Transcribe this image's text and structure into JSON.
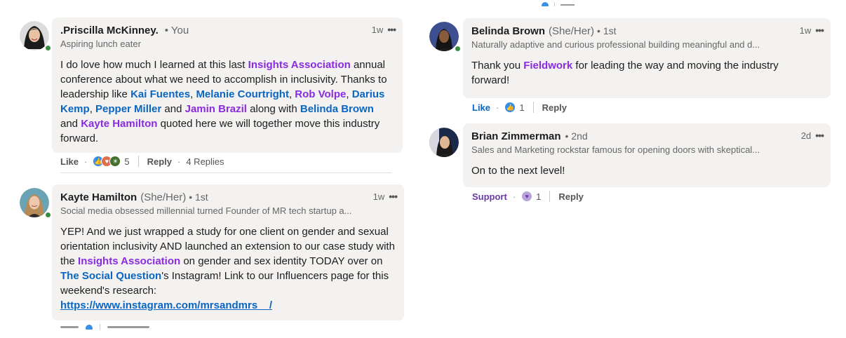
{
  "comments": [
    {
      "name": ".Priscilla McKinney.",
      "badge": "• You",
      "headline": "Aspiring lunch eater",
      "time": "1w",
      "body": {
        "p1": "I do love how much I learned at this last ",
        "m1": "Insights Association",
        "p2": " annual conference about what we need to accomplish in inclusivity. Thanks to leadership like ",
        "m2": "Kai Fuentes",
        "p3": ", ",
        "m3": "Melanie Courtright",
        "p4": ", ",
        "m4": "Rob Volpe",
        "p5": ", ",
        "m5": "Darius Kemp",
        "p6": ", ",
        "m6": "Pepper Miller",
        "p7": " and ",
        "m7": "Jamin Brazil",
        "p8": " along with ",
        "m8": "Belinda Brown",
        "p9": " and ",
        "m9": "Kayte Hamilton",
        "p10": " quoted here we will together move this industry forward."
      },
      "actions": {
        "like": "Like",
        "reaction_count": "5",
        "reply": "Reply",
        "replies": "4 Replies"
      }
    },
    {
      "name": "Kayte Hamilton",
      "pronouns": "(She/Her)",
      "degree": "• 1st",
      "headline": "Social media obsessed millennial turned Founder of MR tech startup a...",
      "time": "1w",
      "body": {
        "p1": "YEP! And we just wrapped a study for one client on gender and sexual orientation inclusivity AND launched an extension to our case study with the ",
        "m1": "Insights Association",
        "p2": " on gender and sex identity TODAY over on ",
        "m2": "The Social Question",
        "p3": "'s Instagram! Link to our Influencers page for this weekend's research:",
        "link": "https://www.instagram.com/mrsandmrs__/"
      }
    },
    {
      "name": "Belinda Brown",
      "pronouns": "(She/Her)",
      "degree": "• 1st",
      "headline": "Naturally adaptive and curious professional building meaningful and d...",
      "time": "1w",
      "body": {
        "p1": "Thank you ",
        "m1": "Fieldwork",
        "p2": " for leading the way and moving the industry forward!"
      },
      "actions": {
        "like": "Like",
        "reaction_count": "1",
        "reply": "Reply"
      }
    },
    {
      "name": "Brian Zimmerman",
      "degree": "• 2nd",
      "headline": "Sales and Marketing rockstar famous for opening doors with skeptical...",
      "time": "2d",
      "body": {
        "p1": "On to the next level!"
      },
      "actions": {
        "support": "Support",
        "reaction_count": "1",
        "reply": "Reply"
      }
    }
  ],
  "icons": {
    "more": "more-options-icon",
    "like": "like-reaction-icon",
    "love": "love-reaction-icon",
    "insightful": "insightful-reaction-icon",
    "support": "support-reaction-icon"
  },
  "colors": {
    "bubble": "#f3f2f0",
    "mention_blue": "#0a66c2",
    "mention_purple": "#8a2be2",
    "online": "#378f3d"
  }
}
